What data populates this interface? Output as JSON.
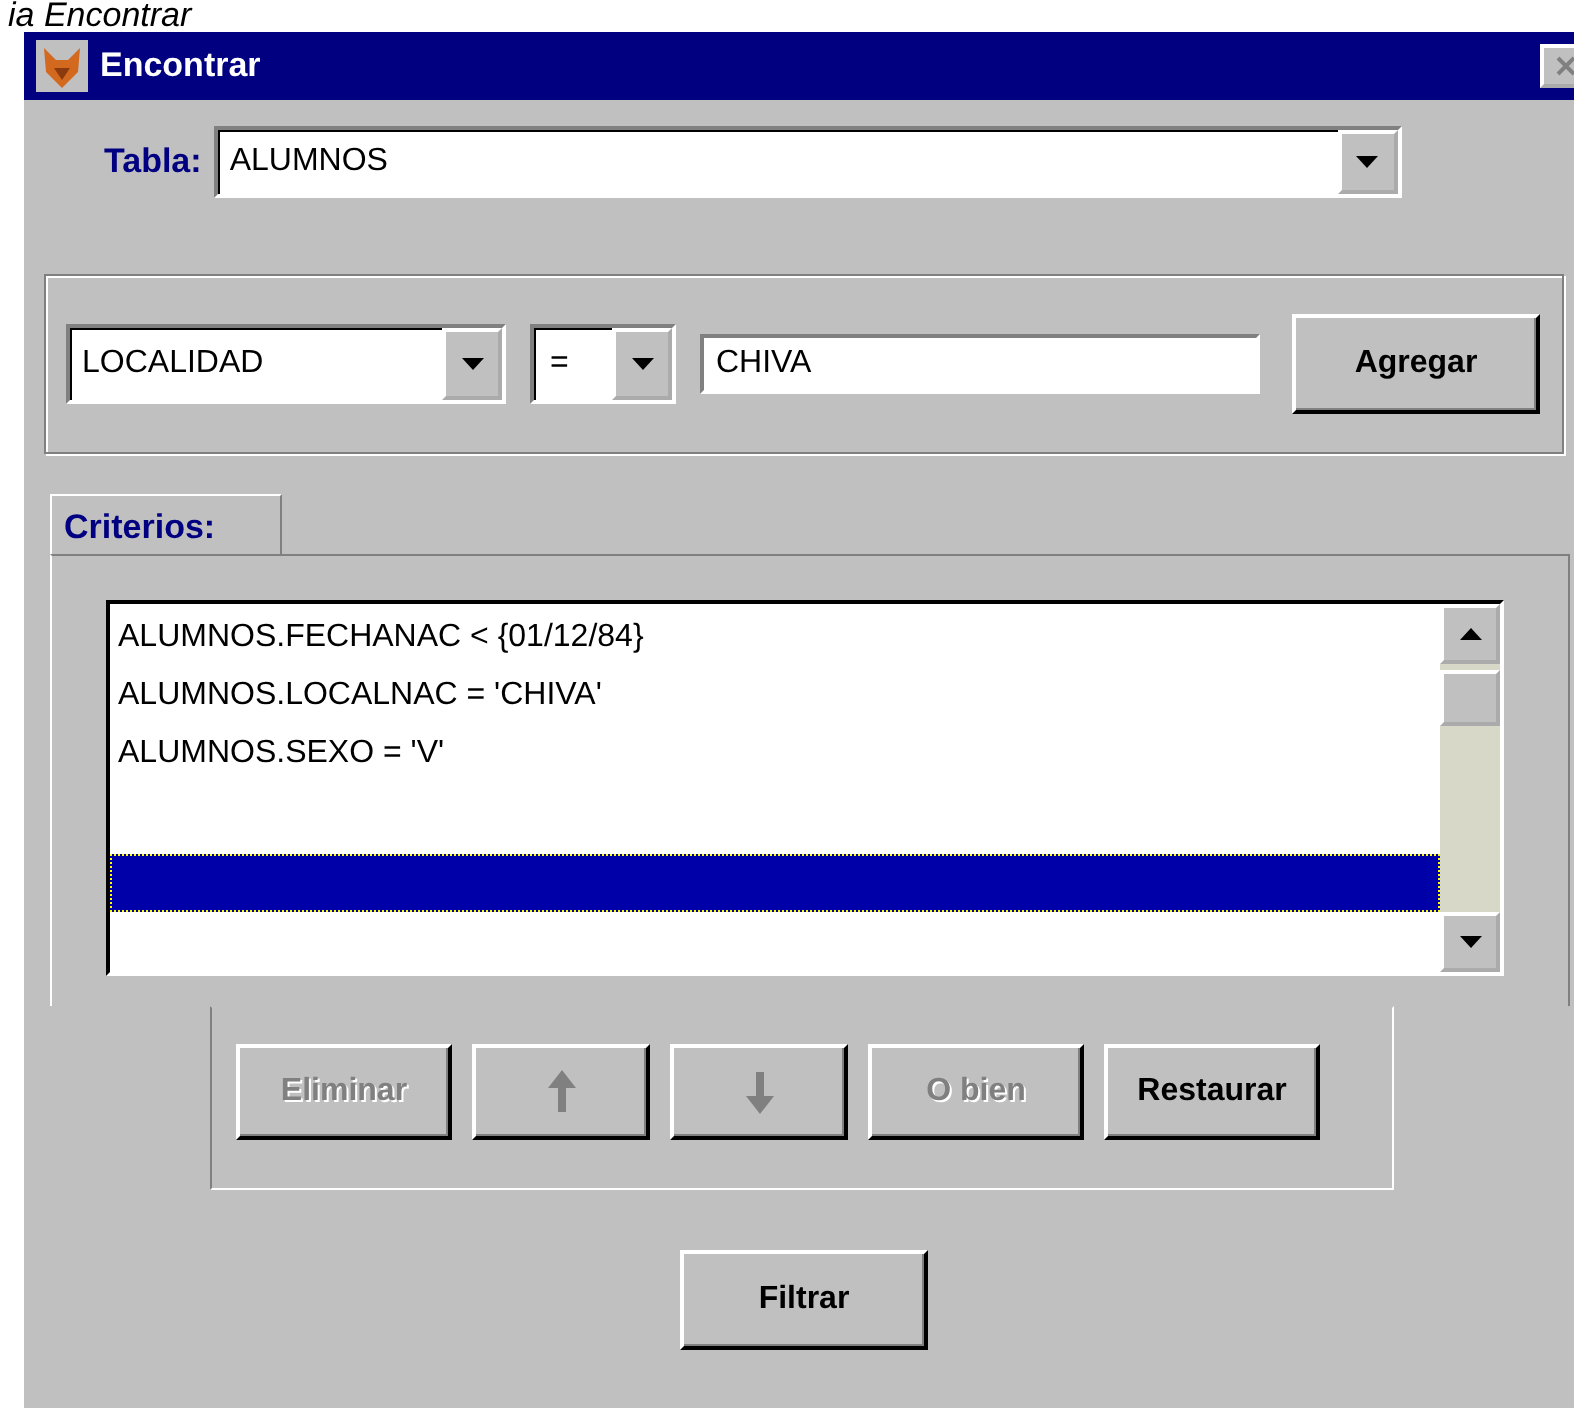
{
  "caption": "ia Encontrar",
  "window": {
    "title": "Encontrar"
  },
  "table_field": {
    "label": "Tabla:",
    "value": "ALUMNOS"
  },
  "condition": {
    "field": "LOCALIDAD",
    "operator": "=",
    "value": "CHIVA",
    "button": "Agregar"
  },
  "criteria": {
    "tab": "Criterios:",
    "items": [
      {
        "text": "ALUMNOS.FECHANAC < {01/12/84}",
        "selected": false
      },
      {
        "text": "ALUMNOS.LOCALNAC = 'CHIVA'",
        "selected": false
      },
      {
        "text": "ALUMNOS.SEXO = 'V'",
        "selected": false
      },
      {
        "selected": true
      }
    ],
    "buttons": [
      {
        "kind": "text",
        "label": "Eliminar",
        "disabled": true
      },
      {
        "kind": "up",
        "disabled": true
      },
      {
        "kind": "down",
        "disabled": true
      },
      {
        "kind": "text",
        "label": "O bien",
        "disabled": true
      },
      {
        "kind": "text",
        "label": "Restaurar",
        "disabled": false
      }
    ]
  },
  "filter_button": "Filtrar"
}
